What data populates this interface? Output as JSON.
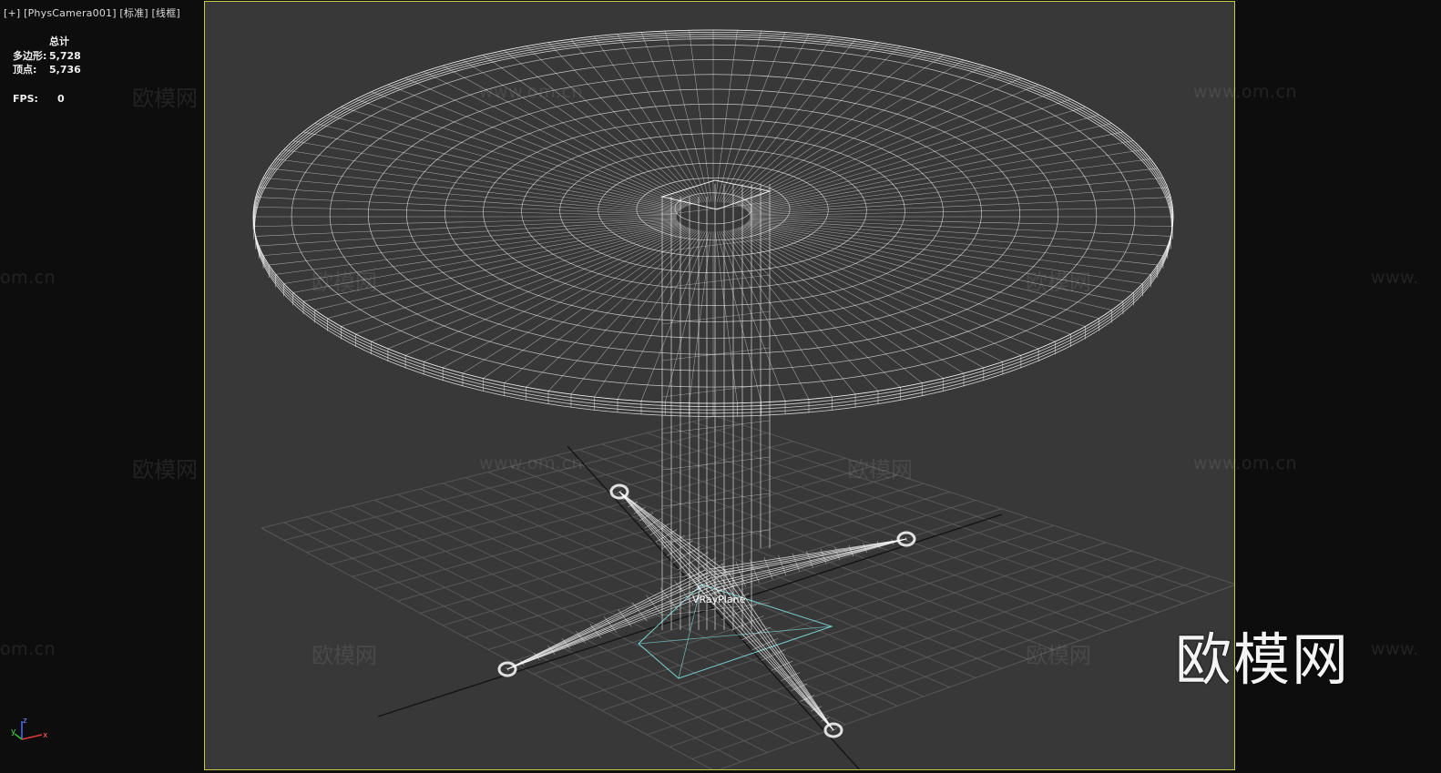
{
  "viewport": {
    "plus": "[+]",
    "camera": "[PhysCamera001]",
    "shading": "[标准]",
    "mode": "[线框]"
  },
  "stats": {
    "header": "总计",
    "polys_label": "多边形:",
    "polys_value": "5,728",
    "verts_label": "顶点:",
    "verts_value": "5,736",
    "fps_label": "FPS:",
    "fps_value": "0"
  },
  "scene": {
    "object_label": "VRayPlane",
    "wire_color": "#ffffff",
    "grid_color": "#5a5a5a",
    "axis_line_color": "#111111",
    "plane_color": "#7fe0e0",
    "frame_border_color": "#c8c84a",
    "viewport_bg": "#383838"
  },
  "watermarks": {
    "text_cn": "欧模网",
    "text_url": "www.om.cn",
    "text_url_short": "om.cn",
    "text_www": "www."
  },
  "brand": {
    "logo_text": "欧模网"
  },
  "axis_gizmo": {
    "x": "x",
    "y": "y",
    "z": "z"
  }
}
